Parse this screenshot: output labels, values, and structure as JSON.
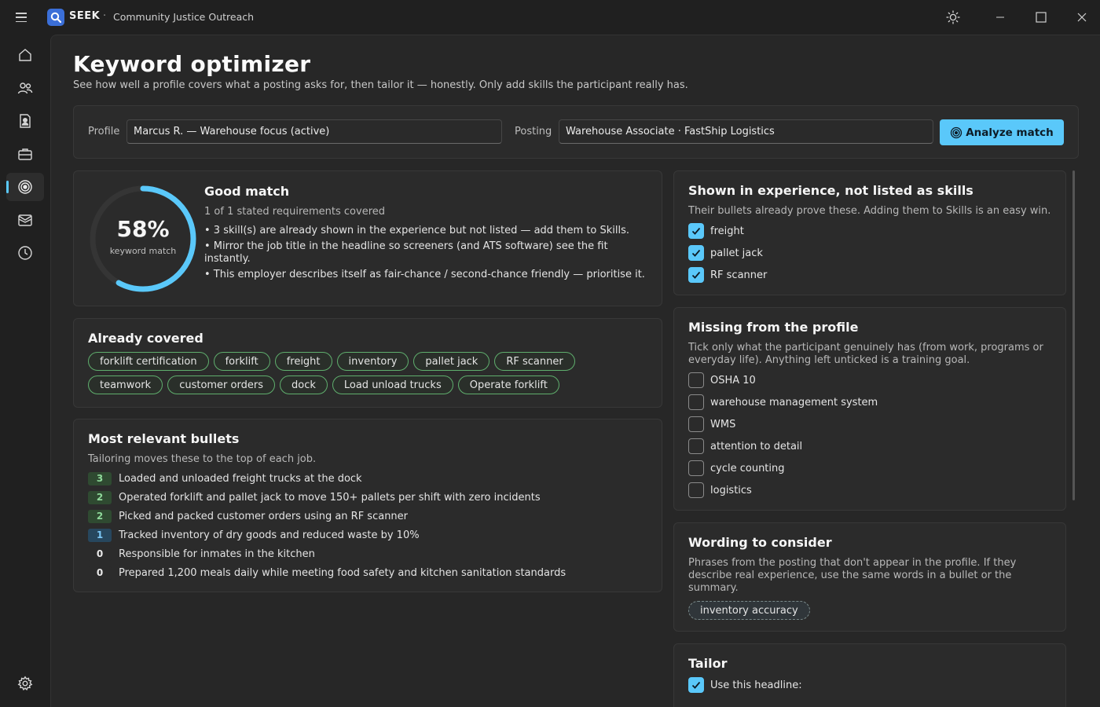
{
  "app": {
    "name": "SEEK",
    "separator": "·",
    "org": "Community Justice Outreach"
  },
  "page": {
    "title": "Keyword optimizer",
    "subtitle": "See how well a profile covers what a posting asks for, then tailor it — honestly. Only add skills the participant really has."
  },
  "selector": {
    "profile_label": "Profile",
    "profile_value": "Marcus R. — Warehouse focus  (active)",
    "posting_label": "Posting",
    "posting_value": "Warehouse Associate · FastShip Logistics",
    "analyze_label": "Analyze match"
  },
  "match": {
    "percent": 58,
    "percent_text": "58%",
    "gauge_label": "keyword match",
    "title": "Good match",
    "summary": "1 of 1 stated requirements covered",
    "bullets": [
      "• 3 skill(s) are already shown in the experience but not listed — add them to Skills.",
      "• Mirror the job title in the headline so screeners (and ATS software) see the fit instantly.",
      "• This employer describes itself as fair-chance / second-chance friendly — prioritise it."
    ]
  },
  "covered": {
    "title": "Already covered",
    "chips": [
      "forklift certification",
      "forklift",
      "freight",
      "inventory",
      "pallet jack",
      "RF scanner",
      "teamwork",
      "customer orders",
      "dock",
      "Load unload trucks",
      "Operate forklift"
    ]
  },
  "relevant": {
    "title": "Most relevant bullets",
    "desc": "Tailoring moves these to the top of each job.",
    "items": [
      {
        "score": "3",
        "text": "Loaded and unloaded freight trucks at the dock"
      },
      {
        "score": "2",
        "text": "Operated forklift and pallet jack to move 150+ pallets per shift with zero incidents"
      },
      {
        "score": "2",
        "text": "Picked and packed customer orders using an RF scanner"
      },
      {
        "score": "1",
        "text": "Tracked inventory of dry goods and reduced waste by 10%"
      },
      {
        "score": "0",
        "text": "Responsible for inmates in the kitchen"
      },
      {
        "score": "0",
        "text": "Prepared 1,200 meals daily while meeting food safety and kitchen sanitation standards"
      }
    ]
  },
  "shown": {
    "title": "Shown in experience, not listed as skills",
    "desc": "Their bullets already prove these. Adding them to Skills is an easy win.",
    "items": [
      {
        "label": "freight",
        "checked": true
      },
      {
        "label": "pallet jack",
        "checked": true
      },
      {
        "label": "RF scanner",
        "checked": true
      }
    ]
  },
  "missing": {
    "title": "Missing from the profile",
    "desc": "Tick only what the participant genuinely has (from work, programs or everyday life). Anything left unticked is a training goal.",
    "items": [
      {
        "label": "OSHA 10",
        "checked": false
      },
      {
        "label": "warehouse management system",
        "checked": false
      },
      {
        "label": "WMS",
        "checked": false
      },
      {
        "label": "attention to detail",
        "checked": false
      },
      {
        "label": "cycle counting",
        "checked": false
      },
      {
        "label": "logistics",
        "checked": false
      }
    ]
  },
  "wording": {
    "title": "Wording to consider",
    "desc": "Phrases from the posting that don't appear in the profile. If they describe real experience, use the same words in a bullet or the summary.",
    "chip": "inventory accuracy"
  },
  "tailor": {
    "title": "Tailor",
    "headline_option": "Use this headline:",
    "headline_checked": true
  },
  "colors": {
    "accent": "#5ac8fa",
    "covered_chip": "#5fae6d",
    "logo": "#3b6fd8"
  }
}
